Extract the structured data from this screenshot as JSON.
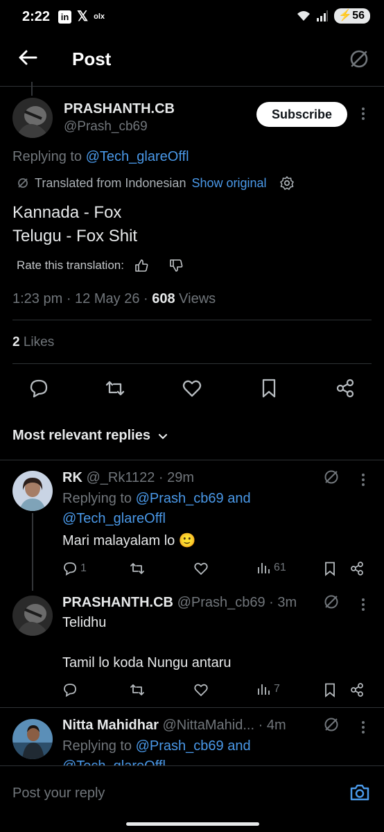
{
  "status_bar": {
    "time": "2:22",
    "left_icons": [
      "linkedin-icon",
      "x-logo-icon",
      "olx-icon"
    ],
    "linkedin_label": "in",
    "x_label": "𝕏",
    "olx_label": "olx",
    "battery": "56"
  },
  "header": {
    "title": "Post"
  },
  "post": {
    "author_name": "PRASHANTH.CB",
    "author_handle": "@Prash_cb69",
    "subscribe_label": "Subscribe",
    "replying_prefix": "Replying to ",
    "replying_to": "@Tech_glareOffl",
    "translated_label": "Translated from Indonesian",
    "show_original": "Show original",
    "text_line1": "Kannada - Fox",
    "text_line2": "Telugu - Fox Shit",
    "rate_label": "Rate this translation:",
    "time": "1:23 pm",
    "date": "12 May 26",
    "views_count": "608",
    "views_label": "Views",
    "likes_count": "2",
    "likes_label": "Likes"
  },
  "replies_filter": "Most relevant replies",
  "replies": [
    {
      "name": "RK",
      "handle": "@_Rk1122",
      "age": "29m",
      "replying_prefix": "Replying to ",
      "replying_to": "@Prash_cb69",
      "replying_and": " and",
      "replying_to2": "@Tech_glareOffl",
      "text": "Mari malayalam lo 🙂",
      "reply_count": "1",
      "views": "61"
    },
    {
      "name": "PRASHANTH.CB",
      "handle": "@Prash_cb69",
      "age": "3m",
      "text_line1": "Telidhu",
      "text_line2": "Tamil lo koda Nungu antaru",
      "views": "7"
    },
    {
      "name": "Nitta Mahidhar",
      "handle": "@NittaMahid...",
      "age": "4m",
      "replying_prefix": "Replying to ",
      "replying_to": "@Prash_cb69",
      "replying_and": " and",
      "replying_to2": "@Tech_glareOffl"
    }
  ],
  "reply_input": {
    "placeholder": "Post your reply"
  },
  "colors": {
    "background": "#000000",
    "text": "#e7e9ea",
    "muted": "#71767b",
    "link": "#4a99e9",
    "separator": "#2f3336"
  }
}
